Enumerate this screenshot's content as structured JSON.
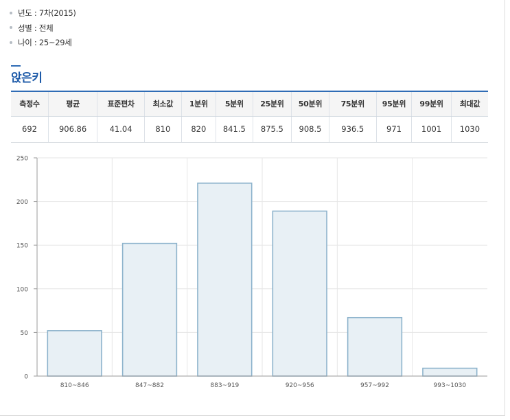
{
  "info": [
    {
      "label": "년도 : 7차(2015)"
    },
    {
      "label": "성별 : 전체"
    },
    {
      "label": "나이 : 25~29세"
    }
  ],
  "section_title": "앉은키",
  "stats_table": {
    "headers": [
      "측정수",
      "평균",
      "표준편차",
      "최소값",
      "1분위",
      "5분위",
      "25분위",
      "50분위",
      "75분위",
      "95분위",
      "99분위",
      "최대값"
    ],
    "values": [
      "692",
      "906.86",
      "41.04",
      "810",
      "820",
      "841.5",
      "875.5",
      "908.5",
      "936.5",
      "971",
      "1001",
      "1030"
    ]
  },
  "chart_data": {
    "type": "bar",
    "categories": [
      "810~846",
      "847~882",
      "883~919",
      "920~956",
      "957~992",
      "993~1030"
    ],
    "values": [
      52,
      152,
      221,
      189,
      67,
      9
    ],
    "ylim": [
      0,
      250
    ],
    "yticks": [
      0,
      50,
      100,
      150,
      200,
      250
    ],
    "grid": true,
    "bar_fill": "#e8f0f5",
    "bar_stroke": "#8db3cc"
  },
  "colors": {
    "accent": "#2f6cb5",
    "title": "#1d5aa8"
  }
}
